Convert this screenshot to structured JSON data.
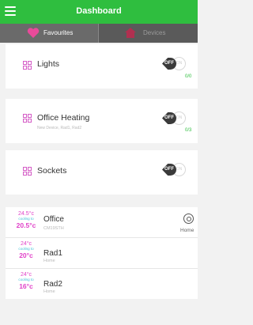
{
  "header": {
    "title": "Dashboard"
  },
  "tabs": [
    {
      "label": "Favourites",
      "icon": "heart-icon",
      "active": true
    },
    {
      "label": "Devices",
      "icon": "house-icon",
      "active": false
    }
  ],
  "groups": [
    {
      "name": "Lights",
      "sub": "",
      "toggle_off": "OFF",
      "toggle_on": "ON",
      "count": "0/0"
    },
    {
      "name": "Office Heating",
      "sub": "New Device, Rad1, Rad2",
      "toggle_off": "OFF",
      "toggle_on": "ON",
      "count": "0/3"
    },
    {
      "name": "Sockets",
      "sub": "",
      "toggle_off": "OFF",
      "toggle_on": "ON",
      "count": ""
    }
  ],
  "devices": [
    {
      "target": "24.5°c",
      "cooling": "cooling to",
      "current": "20.5°c",
      "name": "Office",
      "sub": "CM19STH",
      "mode": "Home",
      "mode_icon": "thermostat-icon"
    },
    {
      "target": "24°c",
      "cooling": "cooling to",
      "current": "20°c",
      "name": "Rad1",
      "sub": "Home",
      "mode": "",
      "mode_icon": ""
    },
    {
      "target": "24°c",
      "cooling": "cooling to",
      "current": "16°c",
      "name": "Rad2",
      "sub": "Home",
      "mode": "",
      "mode_icon": ""
    }
  ],
  "colors": {
    "accent": "#2fbe3f",
    "heat": "#e040c8",
    "cool": "#40c0d8"
  }
}
